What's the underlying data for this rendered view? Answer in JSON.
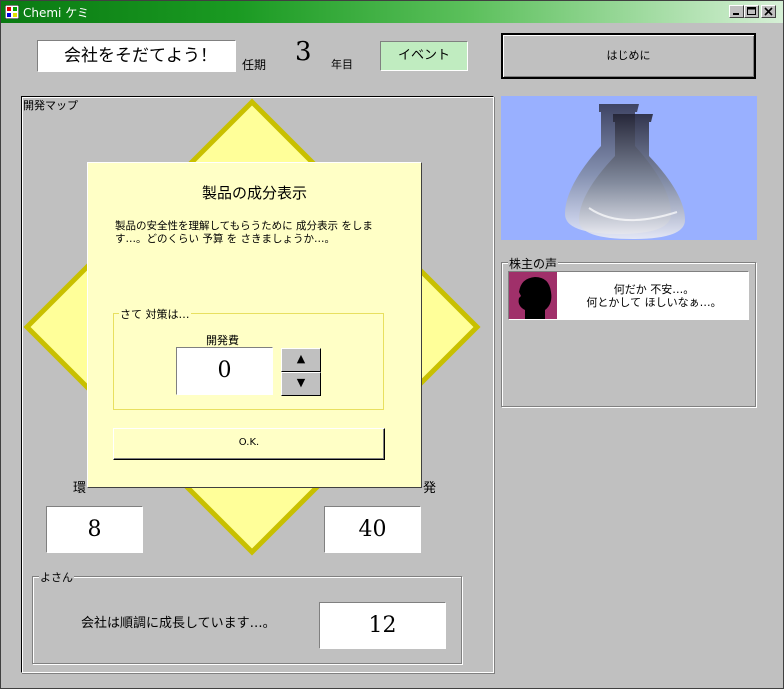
{
  "window": {
    "title": "Chemi ケミ"
  },
  "header": {
    "company_name": "会社をそだてよう！",
    "term_label": "任期",
    "year_value": "3",
    "year_unit": "年目",
    "event_button": "イベント",
    "intro_button": "はじめに"
  },
  "map": {
    "group_label": "開発マップ",
    "left_label": "環",
    "right_label": "発",
    "left_value": "8",
    "right_value": "40"
  },
  "budget": {
    "group_label": "よさん",
    "message": "会社は順調に成長しています…。",
    "value": "12"
  },
  "shareholder": {
    "group_label": "株主の声",
    "line1": "何だか 不安…。",
    "line2": "何とかして ほしいなぁ…。"
  },
  "dialog": {
    "title": "製品の成分表示",
    "description_line1": "製品の安全性を理解してもらうために 成分表示 をしま",
    "description_line2": "す…。どのくらい 予算 を さきましょうか…。",
    "group_label": "さて 対策は…",
    "field_label": "開発費",
    "field_value": "0",
    "up_symbol": "▲",
    "down_symbol": "▼",
    "ok_button": "O.K."
  },
  "colors": {
    "title_green": "#0a7a12",
    "event_bg": "#c0ecc0",
    "dialog_bg": "#ffffc6",
    "diamond_fill": "#ffff99",
    "diamond_border": "#c8c000",
    "flask_bg": "#99b0ff"
  }
}
